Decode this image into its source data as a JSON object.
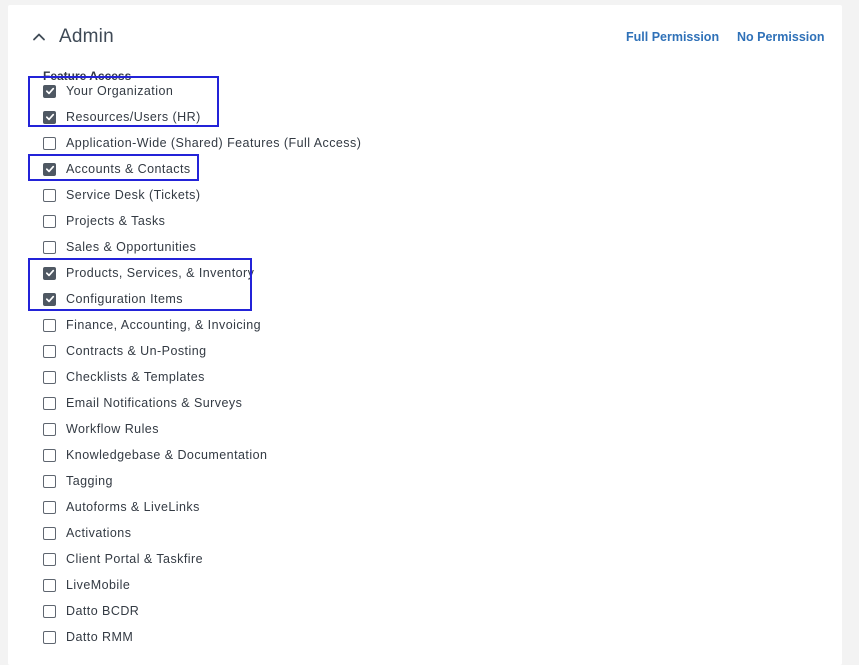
{
  "section": {
    "title": "Admin",
    "collapse_icon": "chevron-up-icon"
  },
  "actions": {
    "full_permission": "Full Permission",
    "no_permission": "No Permission"
  },
  "feature_access": {
    "label": "Feature Access",
    "items": [
      {
        "label": "Your Organization",
        "checked": true
      },
      {
        "label": "Resources/Users (HR)",
        "checked": true
      },
      {
        "label": "Application-Wide (Shared) Features (Full Access)",
        "checked": false
      },
      {
        "label": "Accounts & Contacts",
        "checked": true
      },
      {
        "label": "Service Desk (Tickets)",
        "checked": false
      },
      {
        "label": "Projects & Tasks",
        "checked": false
      },
      {
        "label": "Sales & Opportunities",
        "checked": false
      },
      {
        "label": "Products, Services, & Inventory",
        "checked": true
      },
      {
        "label": "Configuration Items",
        "checked": true
      },
      {
        "label": "Finance, Accounting, & Invoicing",
        "checked": false
      },
      {
        "label": "Contracts & Un-Posting",
        "checked": false
      },
      {
        "label": "Checklists & Templates",
        "checked": false
      },
      {
        "label": "Email Notifications & Surveys",
        "checked": false
      },
      {
        "label": "Workflow Rules",
        "checked": false
      },
      {
        "label": "Knowledgebase & Documentation",
        "checked": false
      },
      {
        "label": "Tagging",
        "checked": false
      },
      {
        "label": "Autoforms & LiveLinks",
        "checked": false
      },
      {
        "label": "Activations",
        "checked": false
      },
      {
        "label": "Client Portal & Taskfire",
        "checked": false
      },
      {
        "label": "LiveMobile",
        "checked": false
      },
      {
        "label": "Datto BCDR",
        "checked": false
      },
      {
        "label": "Datto RMM",
        "checked": false
      }
    ]
  },
  "colors": {
    "highlight": "#2323d8",
    "link": "#2f71b8",
    "checkbox_checked": "#4f5863"
  }
}
